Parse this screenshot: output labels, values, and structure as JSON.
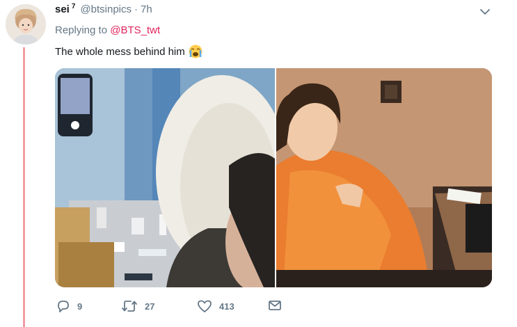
{
  "tweet": {
    "display_name": "sei",
    "name_superscript": "7",
    "handle": "@btsinpics",
    "separator": "·",
    "time": "7h",
    "replying_prefix": "Replying to",
    "replying_to": "@BTS_twt",
    "text": "The whole mess behind him",
    "emoji": "loudly-crying-face-emoji",
    "thread_color": "#f29ba3",
    "link_color": "#e0245e"
  },
  "media": {
    "count": 2
  },
  "actions": {
    "reply_icon": "reply-icon",
    "reply_count": "9",
    "retweet_icon": "retweet-icon",
    "retweet_count": "27",
    "like_icon": "heart-icon",
    "like_count": "413",
    "dm_icon": "envelope-icon"
  }
}
